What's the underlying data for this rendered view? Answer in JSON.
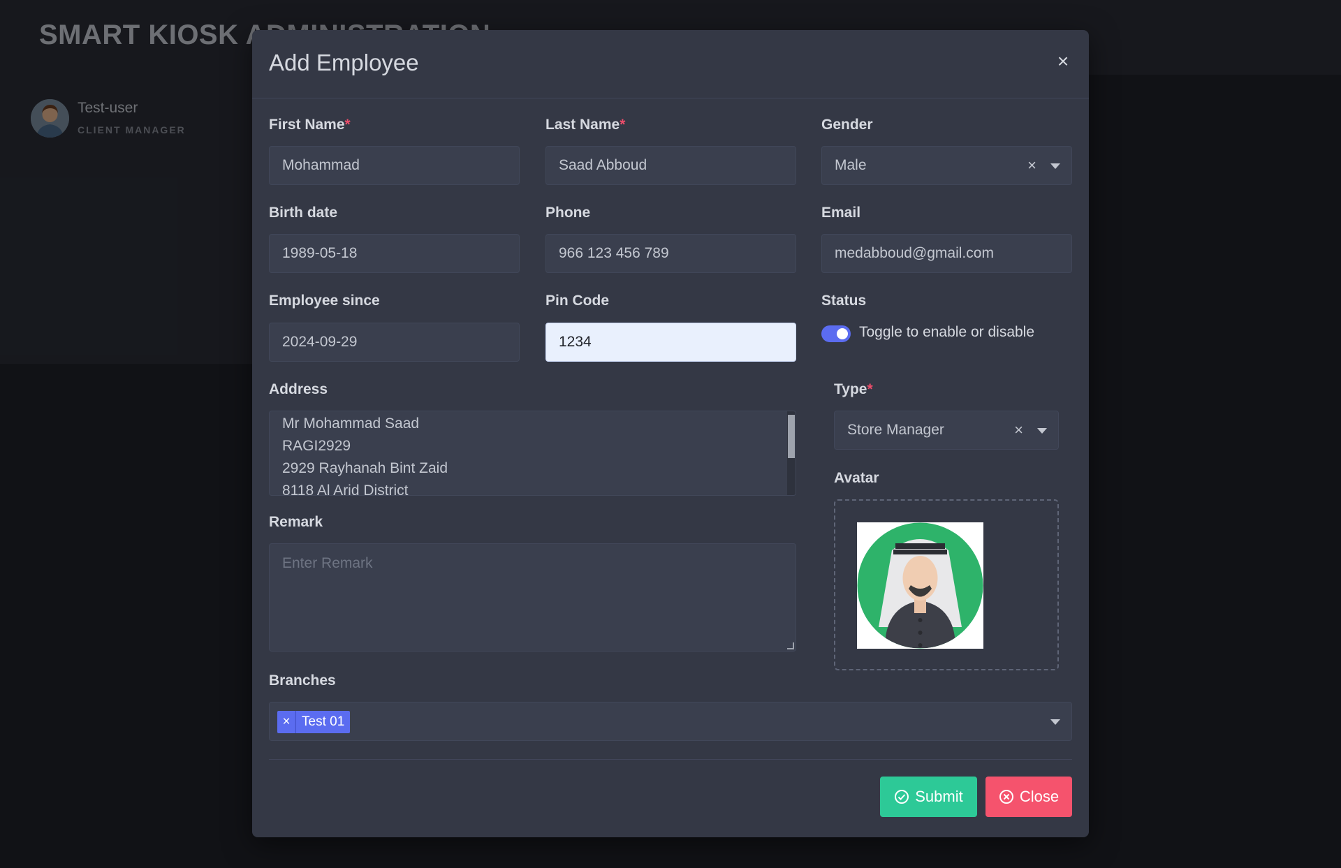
{
  "app": {
    "title": "SMART KIOSK ADMINISTRATION"
  },
  "user": {
    "name": "Test-user",
    "role": "CLIENT MANAGER"
  },
  "modal": {
    "title": "Add Employee",
    "close_label": "×",
    "fields": {
      "first_name": {
        "label": "First Name",
        "required": "*",
        "value": "Mohammad"
      },
      "last_name": {
        "label": "Last Name",
        "required": "*",
        "value": "Saad Abboud"
      },
      "gender": {
        "label": "Gender",
        "value": "Male",
        "clear": "×"
      },
      "birth_date": {
        "label": "Birth date",
        "value": "1989-05-18"
      },
      "phone": {
        "label": "Phone",
        "value": "966 123 456 789"
      },
      "email": {
        "label": "Email",
        "value": "medabboud@gmail.com"
      },
      "employee_since": {
        "label": "Employee since",
        "value": "2024-09-29"
      },
      "pin_code": {
        "label": "Pin Code",
        "value": "1234"
      },
      "status": {
        "label": "Status",
        "toggle_text": "Toggle to enable or disable",
        "enabled": true
      },
      "address": {
        "label": "Address",
        "lines": [
          "Mr Mohammad Saad",
          "RAGI2929",
          "2929 Rayhanah Bint Zaid",
          "8118 Al Arid District"
        ]
      },
      "type": {
        "label": "Type",
        "required": "*",
        "value": "Store Manager",
        "clear": "×"
      },
      "avatar": {
        "label": "Avatar"
      },
      "remark": {
        "label": "Remark",
        "placeholder": "Enter Remark"
      },
      "branches": {
        "label": "Branches",
        "tags": [
          {
            "remove": "×",
            "label": "Test 01"
          }
        ]
      }
    },
    "buttons": {
      "submit": "Submit",
      "close": "Close"
    }
  },
  "colors": {
    "accent": "#5b6cf0",
    "submit": "#2dc997",
    "close": "#f5536d",
    "required": "#ef4d6b",
    "modal_bg": "#343845"
  }
}
